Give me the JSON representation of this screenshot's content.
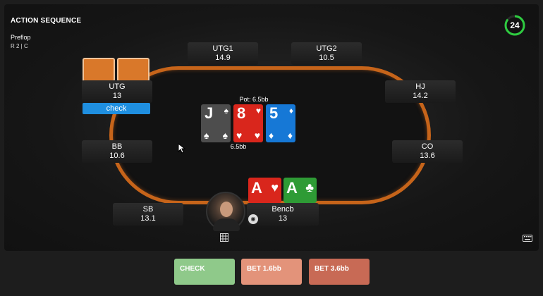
{
  "header": {
    "title": "ACTION SEQUENCE",
    "street": "Preflop",
    "actions": "R 2 | C"
  },
  "timer": {
    "value": "24",
    "color": "#2ecc40"
  },
  "pot": {
    "label": "Pot: 6.5bb",
    "amount": "6.5bb"
  },
  "seats": {
    "utg1": {
      "name": "UTG1",
      "stack": "14.9"
    },
    "utg2": {
      "name": "UTG2",
      "stack": "10.5"
    },
    "utg": {
      "name": "UTG",
      "stack": "13",
      "action": "check"
    },
    "hj": {
      "name": "HJ",
      "stack": "14.2"
    },
    "bb": {
      "name": "BB",
      "stack": "10.6"
    },
    "co": {
      "name": "CO",
      "stack": "13.6"
    },
    "sb": {
      "name": "SB",
      "stack": "13.1"
    },
    "hero": {
      "name": "Bencb",
      "stack": "13"
    }
  },
  "board": [
    {
      "rank": "J",
      "suit": "♠",
      "color": "#4d4d4d"
    },
    {
      "rank": "8",
      "suit": "♥",
      "color": "#d9261c"
    },
    {
      "rank": "5",
      "suit": "♦",
      "color": "#1678d6"
    }
  ],
  "hero_cards": [
    {
      "rank": "A",
      "suit": "♥",
      "color": "#d9261c"
    },
    {
      "rank": "A",
      "suit": "♣",
      "color": "#2e9b35"
    }
  ],
  "buttons": {
    "check": {
      "label": "CHECK",
      "color": "#8fc98a"
    },
    "bet_small": {
      "label": "BET 1.6bb",
      "color": "#e3937a"
    },
    "bet_big": {
      "label": "BET 3.6bb",
      "color": "#c86a55"
    }
  },
  "icons": {
    "timer": "countdown-ring-icon",
    "grid": "grid-icon",
    "keyboard": "keyboard-icon",
    "cursor": "mouse-cursor-icon"
  }
}
